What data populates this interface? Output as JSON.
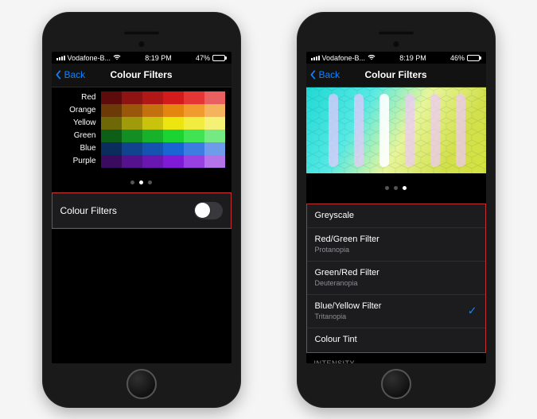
{
  "status": {
    "carrier": "Vodafone-B...",
    "time": "8:19 PM",
    "battery_left": "47%",
    "battery_right": "46%"
  },
  "nav": {
    "back": "Back",
    "title": "Colour Filters"
  },
  "swatches": {
    "labels": [
      "Red",
      "Orange",
      "Yellow",
      "Green",
      "Blue",
      "Purple"
    ],
    "colors": [
      [
        "#5e0b0b",
        "#8e1313",
        "#b11717",
        "#d41b1b",
        "#e63535",
        "#ea5f5f"
      ],
      [
        "#6b3a06",
        "#9a570a",
        "#c3700e",
        "#e48510",
        "#f19b2e",
        "#f5b35d"
      ],
      [
        "#6e6906",
        "#a09b0a",
        "#c9c30d",
        "#ece510",
        "#f2ec40",
        "#f5f176"
      ],
      [
        "#0d5e17",
        "#138e22",
        "#17b12a",
        "#1bd432",
        "#40e352",
        "#75ea82"
      ],
      [
        "#0b2d5e",
        "#12438e",
        "#1653b1",
        "#1b64d4",
        "#3d7de2",
        "#6e9cea"
      ],
      [
        "#3a0b5e",
        "#55128e",
        "#6a16b1",
        "#7f1bd4",
        "#9840e2",
        "#b573ea"
      ]
    ]
  },
  "toggle": {
    "label": "Colour Filters",
    "on": false
  },
  "filters": [
    {
      "title": "Greyscale",
      "sub": ""
    },
    {
      "title": "Red/Green Filter",
      "sub": "Protanopia"
    },
    {
      "title": "Green/Red Filter",
      "sub": "Deuteranopia"
    },
    {
      "title": "Blue/Yellow Filter",
      "sub": "Tritanopia",
      "selected": true
    },
    {
      "title": "Colour Tint",
      "sub": ""
    }
  ],
  "intensity_header": "INTENSITY",
  "page_dots_left": {
    "count": 3,
    "active": 1
  },
  "page_dots_right": {
    "count": 3,
    "active": 2
  }
}
